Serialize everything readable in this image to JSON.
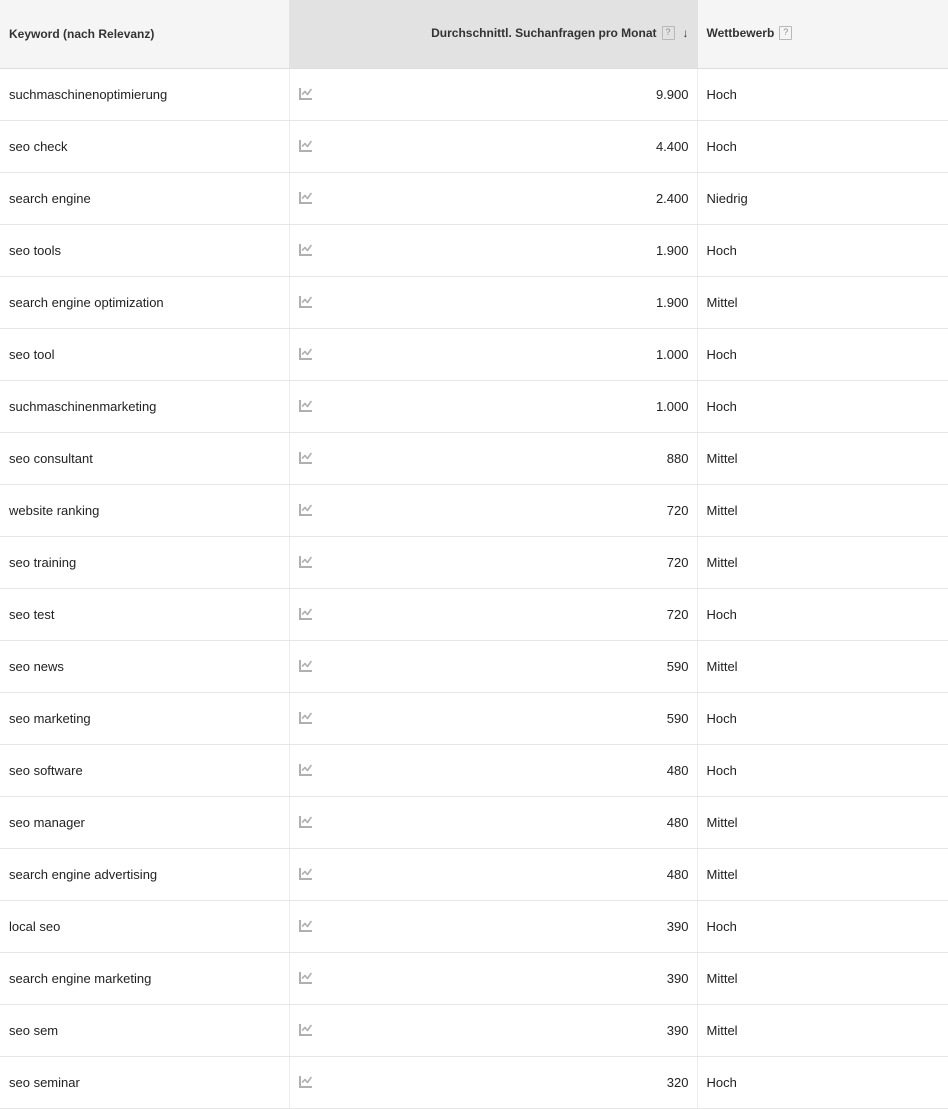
{
  "table": {
    "columns": [
      {
        "key": "keyword",
        "label": "Keyword (nach Relevanz)",
        "has_help": false,
        "sorted": false
      },
      {
        "key": "volume",
        "label": "Durchschnittl. Suchanfragen pro Monat",
        "has_help": true,
        "help_glyph": "?",
        "sorted": true,
        "sort_direction": "descending",
        "sort_arrow_glyph": "↓"
      },
      {
        "key": "competition",
        "label": "Wettbewerb",
        "has_help": true,
        "help_glyph": "?",
        "sorted": false
      }
    ],
    "trend_icon_name": "line-chart-icon",
    "rows": [
      {
        "keyword": "suchmaschinenoptimierung",
        "volume": "9.900",
        "competition": "Hoch"
      },
      {
        "keyword": "seo check",
        "volume": "4.400",
        "competition": "Hoch"
      },
      {
        "keyword": "search engine",
        "volume": "2.400",
        "competition": "Niedrig"
      },
      {
        "keyword": "seo tools",
        "volume": "1.900",
        "competition": "Hoch"
      },
      {
        "keyword": "search engine optimization",
        "volume": "1.900",
        "competition": "Mittel"
      },
      {
        "keyword": "seo tool",
        "volume": "1.000",
        "competition": "Hoch"
      },
      {
        "keyword": "suchmaschinenmarketing",
        "volume": "1.000",
        "competition": "Hoch"
      },
      {
        "keyword": "seo consultant",
        "volume": "880",
        "competition": "Mittel"
      },
      {
        "keyword": "website ranking",
        "volume": "720",
        "competition": "Mittel"
      },
      {
        "keyword": "seo training",
        "volume": "720",
        "competition": "Mittel"
      },
      {
        "keyword": "seo test",
        "volume": "720",
        "competition": "Hoch"
      },
      {
        "keyword": "seo news",
        "volume": "590",
        "competition": "Mittel"
      },
      {
        "keyword": "seo marketing",
        "volume": "590",
        "competition": "Hoch"
      },
      {
        "keyword": "seo software",
        "volume": "480",
        "competition": "Hoch"
      },
      {
        "keyword": "seo manager",
        "volume": "480",
        "competition": "Mittel"
      },
      {
        "keyword": "search engine advertising",
        "volume": "480",
        "competition": "Mittel"
      },
      {
        "keyword": "local seo",
        "volume": "390",
        "competition": "Hoch"
      },
      {
        "keyword": "search engine marketing",
        "volume": "390",
        "competition": "Mittel"
      },
      {
        "keyword": "seo sem",
        "volume": "390",
        "competition": "Mittel"
      },
      {
        "keyword": "seo seminar",
        "volume": "320",
        "competition": "Hoch"
      }
    ]
  },
  "colors": {
    "header_bg": "#f5f5f5",
    "header_sorted_bg": "#e2e2e2",
    "row_bg": "#ffffff",
    "row_border": "#e6e6e6",
    "text": "#222222",
    "icon_gray": "#b0b0b0"
  }
}
